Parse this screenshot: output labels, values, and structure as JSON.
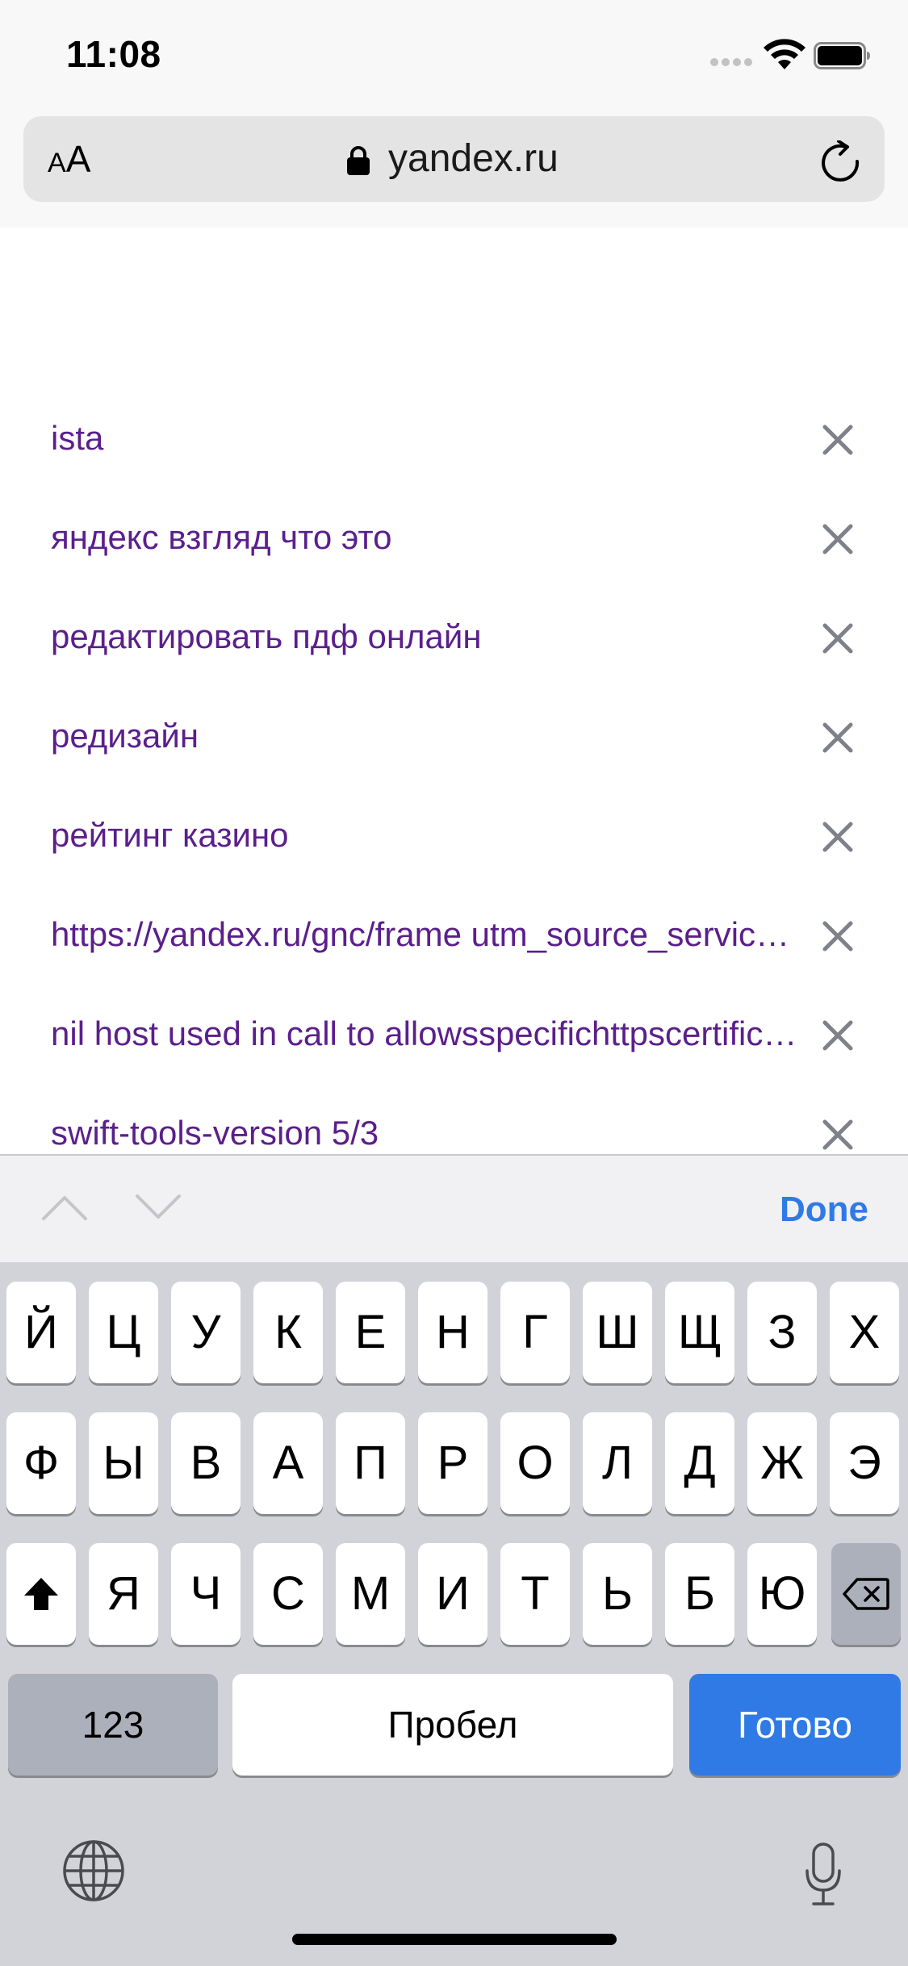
{
  "status_bar": {
    "time": "11:08"
  },
  "address_bar": {
    "text_size_small": "A",
    "text_size_large": "A",
    "url": "yandex.ru"
  },
  "suggestions": [
    "ista",
    "яндекс взгляд что это",
    "редактировать пдф онлайн",
    "редизайн",
    "рейтинг казино",
    "https://yandex.ru/gnc/frame utm_source_service=web&utm_medium=",
    "nil host used in call to allowsspecifichttpscertificateforhost",
    "swift-tools-version 5/3"
  ],
  "accessory_bar": {
    "done_label": "Done"
  },
  "keyboard": {
    "row1": [
      "Й",
      "Ц",
      "У",
      "К",
      "Е",
      "Н",
      "Г",
      "Ш",
      "Щ",
      "З",
      "Х"
    ],
    "row2": [
      "Ф",
      "Ы",
      "В",
      "А",
      "П",
      "Р",
      "О",
      "Л",
      "Д",
      "Ж",
      "Э"
    ],
    "row3": [
      "Я",
      "Ч",
      "С",
      "М",
      "И",
      "Т",
      "Ь",
      "Б",
      "Ю"
    ],
    "numbers_label": "123",
    "space_label": "Пробел",
    "return_label": "Готово"
  },
  "colors": {
    "suggestion_text": "#5b1f8c",
    "accent_blue": "#2f7ae5",
    "keyboard_bg": "#d1d3d9"
  }
}
